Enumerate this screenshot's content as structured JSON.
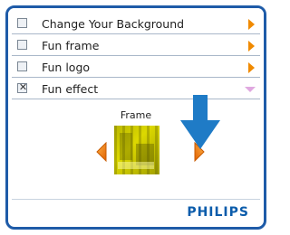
{
  "options": [
    {
      "label": "Change Your Background",
      "checked": false,
      "indicator": "orange-right-arrow-icon"
    },
    {
      "label": "Fun frame",
      "checked": false,
      "indicator": "orange-right-arrow-icon"
    },
    {
      "label": "Fun logo",
      "checked": false,
      "indicator": "orange-right-arrow-icon"
    },
    {
      "label": "Fun effect",
      "checked": true,
      "indicator": "pink-down-arrow-icon"
    }
  ],
  "check_mark": "✕",
  "frame": {
    "title": "Frame"
  },
  "brand": {
    "name": "PHILIPS"
  },
  "colors": {
    "panel_border": "#1e5ba8",
    "accent_orange": "#f08a00",
    "expanded_arrow": "#e0a8e0",
    "brand_blue": "#0b5cab",
    "pointer_blue": "#1f7bc6",
    "preview_yellow": "#e6e000"
  }
}
